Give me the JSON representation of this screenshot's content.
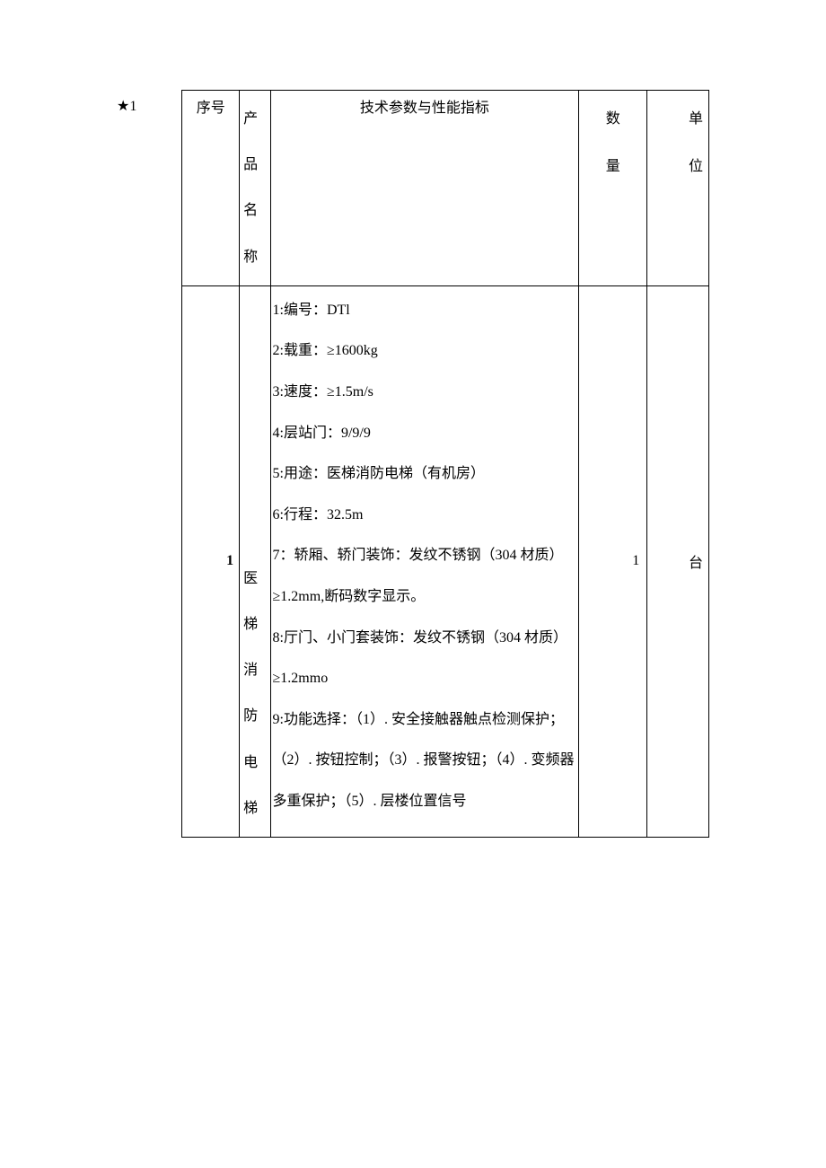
{
  "marker": "★1",
  "headers": {
    "seq": "序号",
    "name_chars": [
      "产",
      "品",
      "名",
      "称"
    ],
    "spec": "技术参数与性能指标",
    "qty_chars": [
      "数",
      "量"
    ],
    "unit_chars": [
      "单",
      "位"
    ]
  },
  "row": {
    "seq": "1",
    "name_chars": [
      "医",
      "梯",
      "消",
      "防",
      "电",
      "梯"
    ],
    "spec": "1:编号：DTl\n2:载重：≥1600kg\n3:速度：≥1.5m/s\n4:层站门：9/9/9\n5:用途：医梯消防电梯（有机房）\n6:行程：32.5m\n7：轿厢、轿门装饰：发纹不锈钢（304 材质）≥1.2mm,断码数字显示。\n8:厅门、小门套装饰：发纹不锈钢（304 材质）≥1.2mmo\n9:功能选择：（1）. 安全接触器触点检测保护；（2）. 按钮控制；（3）. 报警按钮；（4）. 变频器多重保护；（5）. 层楼位置信号",
    "qty": "1",
    "unit": "台"
  }
}
